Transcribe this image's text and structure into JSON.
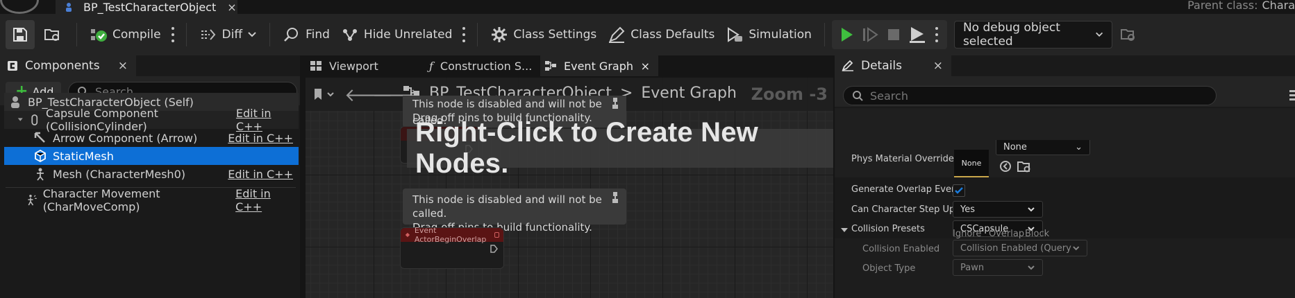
{
  "titlebar": {
    "doc_tab": "BP_TestCharacterObject",
    "close": "×",
    "parent_class_label": "Parent class:",
    "parent_class_value": "Chara"
  },
  "toolbar": {
    "compile": "Compile",
    "diff": "Diff",
    "find": "Find",
    "hide_unrelated": "Hide Unrelated",
    "class_settings": "Class Settings",
    "class_defaults": "Class Defaults",
    "simulation": "Simulation",
    "debug_select": "No debug object selected"
  },
  "components": {
    "tab": "Components",
    "close": "×",
    "add": "Add",
    "search_placeholder": "Search",
    "items": [
      {
        "label": "BP_TestCharacterObject (Self)",
        "edit": ""
      },
      {
        "label": "Capsule Component (CollisionCylinder)",
        "edit": "Edit in C++"
      },
      {
        "label": "Arrow Component (Arrow)",
        "edit": "Edit in C++"
      },
      {
        "label": "StaticMesh",
        "edit": ""
      },
      {
        "label": "Mesh (CharacterMesh0)",
        "edit": "Edit in C++"
      },
      {
        "label": "Character Movement (CharMoveComp)",
        "edit": "Edit in C++"
      }
    ]
  },
  "graph": {
    "tabs": [
      {
        "label": "Viewport"
      },
      {
        "label": "Construction S..."
      },
      {
        "label": "Event Graph",
        "close": "×"
      }
    ],
    "breadcrumb_root": "BP_TestCharacterObject",
    "breadcrumb_sep": ">",
    "breadcrumb_leaf": "Event Graph",
    "zoom": "Zoom -3",
    "hint": "Right-Click to Create New Nodes.",
    "comment_line1": "This node is disabled and will not be called.",
    "comment_line2": "Drag off pins to build functionality.",
    "node_title": "Event ActorBeginOverlap"
  },
  "details": {
    "tab": "Details",
    "close": "×",
    "search_placeholder": "Search",
    "phys_material_label": "Phys Material Override",
    "phys_material_value": "None",
    "phys_material_dropdown": "None",
    "generate_overlap_label": "Generate Overlap Events",
    "generate_overlap_checked": true,
    "step_up_label": "Can Character Step Up On",
    "step_up_value": "Yes",
    "collision_presets_label": "Collision Presets",
    "collision_presets_value": "CSCapsule",
    "collision_enabled_label": "Collision Enabled",
    "collision_enabled_value": "Collision Enabled (Query and Phy",
    "object_type_label": "Object Type",
    "object_type_value": "Pawn",
    "col_ignore": "Ignore",
    "col_overlap": "Overlap",
    "col_block": "Block"
  },
  "colors": {
    "selection": "#0d6fd6",
    "play_green": "#3fbf3f",
    "add_green": "#3dbd3d",
    "event_node_red": "#5a1414"
  }
}
